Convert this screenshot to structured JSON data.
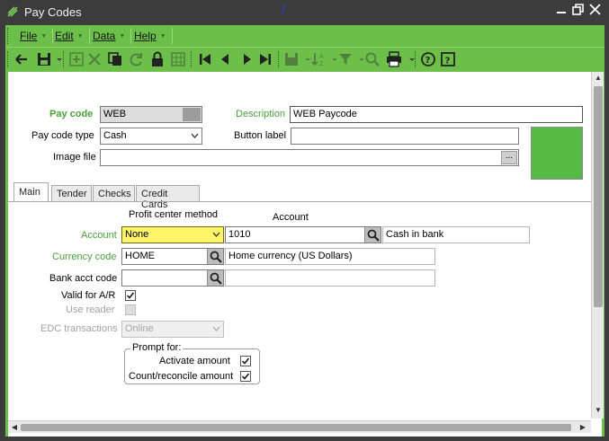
{
  "window": {
    "title": "Pay Codes"
  },
  "menus": [
    {
      "label": "File"
    },
    {
      "label": "Edit"
    },
    {
      "label": "Data"
    },
    {
      "label": "Help"
    }
  ],
  "toolbar": {
    "buttons": [
      "back-arrow-icon",
      "save-icon",
      "add-icon",
      "delete-icon",
      "copy-icon",
      "refresh-icon",
      "lock-icon",
      "grid-icon",
      "first-record-icon",
      "previous-record-icon",
      "next-record-icon",
      "last-record-icon",
      "layout-icon",
      "sort-icon",
      "filter-icon",
      "search-icon",
      "print-icon",
      "help-about-icon",
      "help-topic-icon"
    ]
  },
  "form": {
    "pay_code_label": "Pay code",
    "pay_code_value": "WEB",
    "description_label": "Description",
    "description_value": "WEB Paycode",
    "pay_code_type_label": "Pay code type",
    "pay_code_type_value": "Cash",
    "button_label_label": "Button label",
    "button_label_value": "",
    "image_file_label": "Image file",
    "image_file_value": "",
    "image_browse": "...",
    "swatch_color": "#55bb44"
  },
  "tabs": [
    {
      "label": "Main",
      "active": true
    },
    {
      "label": "Tender"
    },
    {
      "label": "Checks"
    },
    {
      "label": "Credit Cards"
    }
  ],
  "main": {
    "profit_center_header": "Profit center method",
    "account_header": "Account",
    "account_label": "Account",
    "account_method": "None",
    "account_number": "1010",
    "account_name": "Cash in bank",
    "currency_label": "Currency code",
    "currency_value": "HOME",
    "currency_name": "Home currency (US Dollars)",
    "bank_acct_label": "Bank acct code",
    "bank_acct_value": "",
    "bank_acct_name": "",
    "valid_ar_label": "Valid for A/R",
    "valid_ar_checked": true,
    "use_reader_label": "Use reader",
    "use_reader_checked": false,
    "edc_label": "EDC transactions",
    "edc_value": "Online",
    "prompt_for_label": "Prompt for:",
    "activate_amount_label": "Activate amount",
    "activate_amount_checked": true,
    "count_reconcile_label": "Count/reconcile amount",
    "count_reconcile_checked": true
  },
  "colors": {
    "accent_green": "#6cc04a",
    "label_green": "#4aa03a",
    "required_yellow": "#fff56a"
  }
}
